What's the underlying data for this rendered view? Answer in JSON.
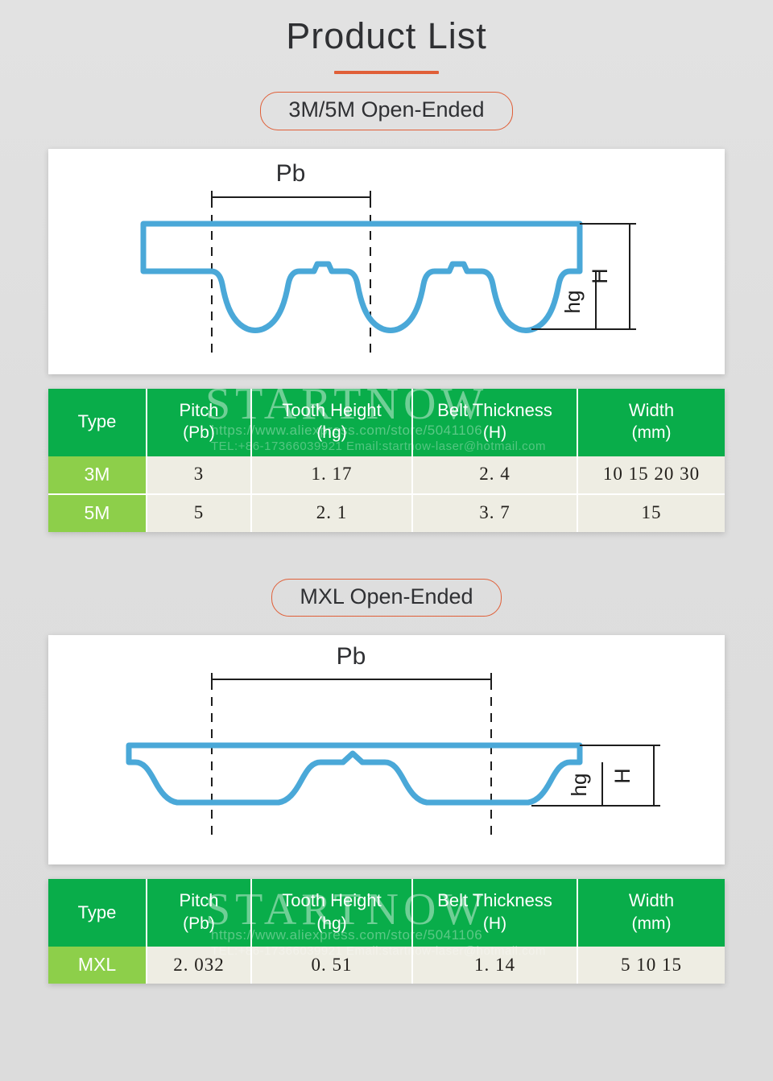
{
  "header": {
    "title": "Product List"
  },
  "sections": [
    {
      "badge": "3M/5M Open-Ended",
      "diagram": {
        "pitch_label": "Pb",
        "tooth_height_label": "hg",
        "belt_thickness_label": "H",
        "profile": "curvilinear-round-tooth"
      },
      "table": {
        "headers": [
          {
            "main": "Type",
            "sub": ""
          },
          {
            "main": "Pitch",
            "sub": "(Pb)"
          },
          {
            "main": "Tooth Height",
            "sub": "(hg)"
          },
          {
            "main": "Belt Thickness",
            "sub": "(H)"
          },
          {
            "main": "Width",
            "sub": "(mm)"
          }
        ],
        "rows": [
          {
            "type": "3M",
            "pitch": "3",
            "tooth_height": "1. 17",
            "belt_thickness": "2. 4",
            "width": "10 15 20 30"
          },
          {
            "type": "5M",
            "pitch": "5",
            "tooth_height": "2. 1",
            "belt_thickness": "3. 7",
            "width": "15"
          }
        ]
      }
    },
    {
      "badge": "MXL Open-Ended",
      "diagram": {
        "pitch_label": "Pb",
        "tooth_height_label": "hg",
        "belt_thickness_label": "H",
        "profile": "trapezoidal-tooth"
      },
      "table": {
        "headers": [
          {
            "main": "Type",
            "sub": ""
          },
          {
            "main": "Pitch",
            "sub": "(Pb)"
          },
          {
            "main": "Tooth Height",
            "sub": "(hg)"
          },
          {
            "main": "Belt Thickness",
            "sub": "(H)"
          },
          {
            "main": "Width",
            "sub": "(mm)"
          }
        ],
        "rows": [
          {
            "type": "MXL",
            "pitch": "2. 032",
            "tooth_height": "0. 51",
            "belt_thickness": "1. 14",
            "width": "5 10 15"
          }
        ]
      }
    }
  ],
  "watermark": {
    "brand": "STARTNOW",
    "url": "https://www.aliexpress.com/store/5041106",
    "contact": "TEL:+86-17366039921     Email:startnow-laser@hotmail.com"
  },
  "colors": {
    "accent_orange": "#e05f38",
    "header_green": "#09ad4a",
    "type_green": "#8dcf4a",
    "cell_cream": "#eeede3",
    "belt_blue": "#4aa8d8",
    "page_bg": "#dedede",
    "text_dark": "#2f3033"
  }
}
